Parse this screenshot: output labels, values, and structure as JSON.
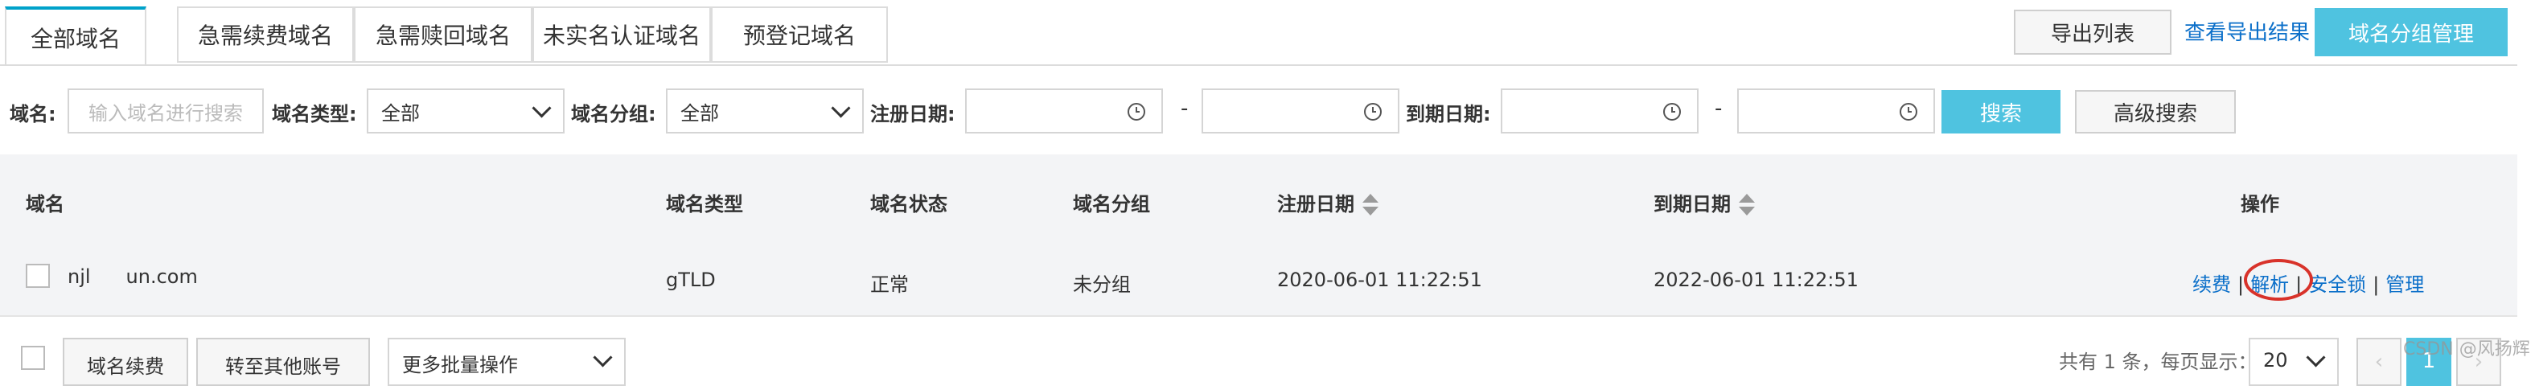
{
  "tabs": [
    {
      "label": "全部域名"
    },
    {
      "label": "急需续费域名"
    },
    {
      "label": "急需赎回域名"
    },
    {
      "label": "未实名认证域名"
    },
    {
      "label": "预登记域名"
    }
  ],
  "header_actions": {
    "export_list": "导出列表",
    "view_export": "查看导出结果",
    "group_manage": "域名分组管理"
  },
  "filters": {
    "domain_label": "域名:",
    "domain_placeholder": "输入域名进行搜索",
    "type_label": "域名类型:",
    "type_value": "全部",
    "group_label": "域名分组:",
    "group_value": "全部",
    "reg_date_label": "注册日期:",
    "exp_date_label": "到期日期:",
    "range_sep": "-",
    "search": "搜索",
    "advanced": "高级搜索"
  },
  "table": {
    "headers": {
      "domain": "域名",
      "type": "域名类型",
      "status": "域名状态",
      "group": "域名分组",
      "reg_date": "注册日期",
      "exp_date": "到期日期",
      "actions": "操作"
    },
    "rows": [
      {
        "domain_a": "njl",
        "domain_b": "un.com",
        "type": "gTLD",
        "status": "正常",
        "group": "未分组",
        "reg_date": "2020-06-01 11:22:51",
        "exp_date": "2022-06-01 11:22:51",
        "actions": [
          "续费",
          "解析",
          "安全锁",
          "管理"
        ],
        "highlighted_action": "解析"
      }
    ],
    "action_sep": "|"
  },
  "footer": {
    "renew": "域名续费",
    "transfer": "转至其他账号",
    "batch": "更多批量操作",
    "total": "共有 1 条，每页显示：",
    "page_size": "20",
    "page": "1"
  },
  "watermark": "CSDN @风扬辉",
  "colors": {
    "accent": "#4fc3e0",
    "link": "#0b6fc9",
    "highlight_circle": "#d8322a"
  }
}
